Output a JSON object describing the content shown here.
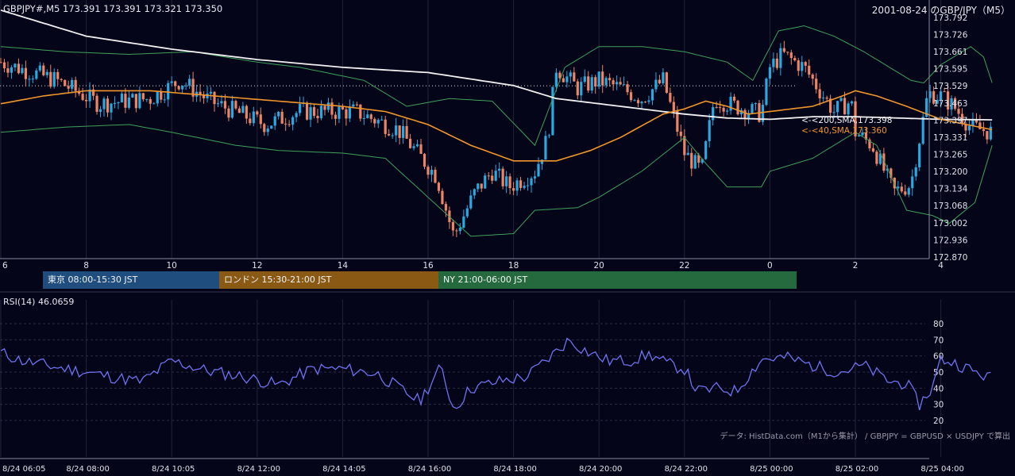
{
  "header": {
    "symbol_line": "GBPJPY#,M5 173.391 173.391 173.321 173.350",
    "right_title": "2001-08-24 のGBP/JPY（M5）"
  },
  "sessions": [
    {
      "label": "東京 08:00-15:30 JST",
      "color": "#1f4d7e"
    },
    {
      "label": "ロンドン 15:30-21:00 JST",
      "color": "#8a5a14"
    },
    {
      "label": "NY 21:00-06:00 JST",
      "color": "#256a3f"
    }
  ],
  "rsi_label": "RSI(14) 46.0659",
  "credit": "データ: HistData.com（M1から集計） / GBPJPY = GBPUSD × USDJPY で算出",
  "colors": {
    "background": "#05051a",
    "bull": "#2aa8e0",
    "bear": "#ee8466",
    "sma200": "#f0f0f0",
    "sma40": "#f0962a",
    "bollinger": "#3fa05a",
    "rsi": "#6f72f0",
    "grid": "#22223a"
  },
  "chart_data": [
    {
      "type": "candlestick",
      "title": "GBPJPY#,M5",
      "ylim": [
        172.87,
        173.792
      ],
      "y_ticks": [
        "173.792",
        "173.726",
        "173.661",
        "173.595",
        "173.529",
        "173.463",
        "173.397",
        "173.331",
        "173.265",
        "173.200",
        "173.134",
        "173.068",
        "173.002",
        "172.936",
        "172.870"
      ],
      "x_ticks": [
        "6",
        "8",
        "10",
        "12",
        "14",
        "16",
        "18",
        "20",
        "22",
        "0",
        "2",
        "4"
      ],
      "last_close_line": 173.529,
      "legend": [
        {
          "label": "<-<200,SMA,173.398",
          "color": "#f0f0f0"
        },
        {
          "label": "<-<40,SMA,173.360",
          "color": "#f0962a"
        }
      ],
      "waypoints_time_h": [
        6.0,
        7.3,
        8.3,
        9.5,
        10.2,
        10.9,
        12.2,
        13.0,
        14.3,
        15.3,
        15.7,
        16.2,
        16.6,
        17.1,
        17.5,
        17.9,
        18.5,
        18.8,
        19.0,
        19.5,
        20.0,
        20.5,
        21.0,
        21.5,
        22.0,
        22.4,
        22.7,
        23.2,
        23.8,
        24.0,
        24.3,
        24.8,
        25.5,
        25.9,
        26.0,
        26.4,
        26.9,
        27.3,
        27.7,
        28.0,
        28.3,
        28.7,
        29.2
      ],
      "waypoints_price": [
        173.62,
        173.55,
        173.46,
        173.48,
        173.55,
        173.47,
        173.38,
        173.43,
        173.43,
        173.36,
        173.28,
        173.18,
        172.95,
        173.12,
        173.2,
        173.14,
        173.2,
        173.33,
        173.6,
        173.52,
        173.55,
        173.52,
        173.48,
        173.55,
        173.27,
        173.2,
        173.48,
        173.45,
        173.42,
        173.6,
        173.65,
        173.6,
        173.43,
        173.47,
        173.35,
        173.3,
        173.12,
        173.15,
        173.5,
        173.49,
        173.45,
        173.37,
        173.35
      ],
      "sma200_points": [
        [
          6.0,
          173.82
        ],
        [
          8.0,
          173.72
        ],
        [
          10.0,
          173.67
        ],
        [
          12.0,
          173.63
        ],
        [
          14.0,
          173.6
        ],
        [
          16.0,
          173.58
        ],
        [
          18.0,
          173.53
        ],
        [
          19.0,
          173.48
        ],
        [
          20.0,
          173.46
        ],
        [
          21.0,
          173.44
        ],
        [
          22.0,
          173.42
        ],
        [
          23.0,
          173.405
        ],
        [
          24.0,
          173.4
        ],
        [
          25.0,
          173.41
        ],
        [
          26.0,
          173.41
        ],
        [
          27.0,
          173.405
        ],
        [
          28.0,
          173.4
        ],
        [
          29.2,
          173.398
        ]
      ],
      "sma40_points": [
        [
          6.0,
          173.46
        ],
        [
          7.0,
          173.49
        ],
        [
          8.0,
          173.51
        ],
        [
          9.5,
          173.51
        ],
        [
          11.0,
          173.49
        ],
        [
          12.5,
          173.47
        ],
        [
          14.0,
          173.45
        ],
        [
          15.0,
          173.43
        ],
        [
          16.0,
          173.38
        ],
        [
          17.0,
          173.3
        ],
        [
          18.0,
          173.24
        ],
        [
          19.0,
          173.24
        ],
        [
          19.8,
          173.28
        ],
        [
          20.5,
          173.33
        ],
        [
          21.5,
          173.42
        ],
        [
          22.0,
          173.44
        ],
        [
          22.5,
          173.47
        ],
        [
          23.0,
          173.45
        ],
        [
          23.5,
          173.42
        ],
        [
          24.0,
          173.43
        ],
        [
          25.0,
          173.45
        ],
        [
          25.7,
          173.49
        ],
        [
          26.0,
          173.51
        ],
        [
          26.5,
          173.49
        ],
        [
          27.2,
          173.45
        ],
        [
          28.0,
          173.4
        ],
        [
          29.2,
          173.36
        ]
      ],
      "upper_band_points": [
        [
          6.0,
          173.68
        ],
        [
          7.5,
          173.66
        ],
        [
          9.0,
          173.65
        ],
        [
          10.5,
          173.66
        ],
        [
          12.0,
          173.62
        ],
        [
          13.0,
          173.6
        ],
        [
          14.5,
          173.55
        ],
        [
          15.5,
          173.45
        ],
        [
          16.5,
          173.48
        ],
        [
          17.5,
          173.47
        ],
        [
          18.5,
          173.3
        ],
        [
          19.2,
          173.6
        ],
        [
          20.0,
          173.68
        ],
        [
          21.0,
          173.68
        ],
        [
          22.0,
          173.66
        ],
        [
          23.0,
          173.62
        ],
        [
          23.6,
          173.55
        ],
        [
          24.2,
          173.74
        ],
        [
          24.8,
          173.76
        ],
        [
          25.5,
          173.72
        ],
        [
          26.2,
          173.66
        ],
        [
          26.8,
          173.6
        ],
        [
          27.3,
          173.55
        ],
        [
          27.6,
          173.54
        ],
        [
          28.0,
          173.61
        ],
        [
          28.7,
          173.68
        ],
        [
          29.0,
          173.64
        ],
        [
          29.2,
          173.54
        ]
      ],
      "lower_band_points": [
        [
          6.0,
          173.35
        ],
        [
          7.5,
          173.37
        ],
        [
          9.0,
          173.38
        ],
        [
          10.0,
          173.35
        ],
        [
          11.5,
          173.3
        ],
        [
          12.5,
          173.28
        ],
        [
          14.0,
          173.27
        ],
        [
          15.0,
          173.25
        ],
        [
          16.0,
          173.1
        ],
        [
          17.0,
          172.95
        ],
        [
          18.0,
          172.96
        ],
        [
          18.5,
          173.05
        ],
        [
          19.5,
          173.06
        ],
        [
          20.0,
          173.1
        ],
        [
          21.0,
          173.2
        ],
        [
          22.0,
          173.33
        ],
        [
          22.5,
          173.23
        ],
        [
          23.0,
          173.14
        ],
        [
          23.8,
          173.14
        ],
        [
          24.0,
          173.2
        ],
        [
          25.0,
          173.25
        ],
        [
          26.0,
          173.35
        ],
        [
          26.5,
          173.3
        ],
        [
          27.2,
          173.05
        ],
        [
          27.8,
          173.03
        ],
        [
          28.2,
          173.0
        ],
        [
          28.8,
          173.08
        ],
        [
          29.2,
          173.3
        ]
      ]
    },
    {
      "type": "line",
      "title": "RSI(14) 46.0659",
      "ylim": [
        15,
        88
      ],
      "y_ticks": [
        "80",
        "70",
        "60",
        "50",
        "40",
        "30",
        "20"
      ],
      "x_ticks": [
        "8/24 06:05",
        "8/24 08:00",
        "8/24 10:05",
        "8/24 12:00",
        "8/24 14:05",
        "8/24 16:00",
        "8/24 18:00",
        "8/24 20:00",
        "8/24 22:00",
        "8/25 00:00",
        "8/25 02:00",
        "8/25 04:00"
      ],
      "series": [
        {
          "waypoints_time_h": [
            6.0,
            6.5,
            7.3,
            8.0,
            8.6,
            9.3,
            10.0,
            10.8,
            11.7,
            12.5,
            13.3,
            14.0,
            14.8,
            15.5,
            15.8,
            16.3,
            16.6,
            17.0,
            17.8,
            18.3,
            18.8,
            19.3,
            19.7,
            20.2,
            20.7,
            21.2,
            21.6,
            22.0,
            22.3,
            22.8,
            23.2,
            23.8,
            24.4,
            25.0,
            25.6,
            26.2,
            26.8,
            27.2,
            27.5,
            27.8,
            28.0,
            28.4,
            28.8,
            29.2
          ],
          "waypoints_value": [
            62,
            57,
            53,
            50,
            47,
            44,
            57,
            51,
            47,
            42,
            52,
            52,
            49,
            37,
            32,
            53,
            27,
            40,
            45,
            47,
            58,
            70,
            63,
            57,
            57,
            61,
            55,
            52,
            38,
            40,
            38,
            58,
            59,
            54,
            50,
            54,
            44,
            43,
            30,
            40,
            58,
            55,
            50,
            46
          ]
        }
      ]
    }
  ]
}
